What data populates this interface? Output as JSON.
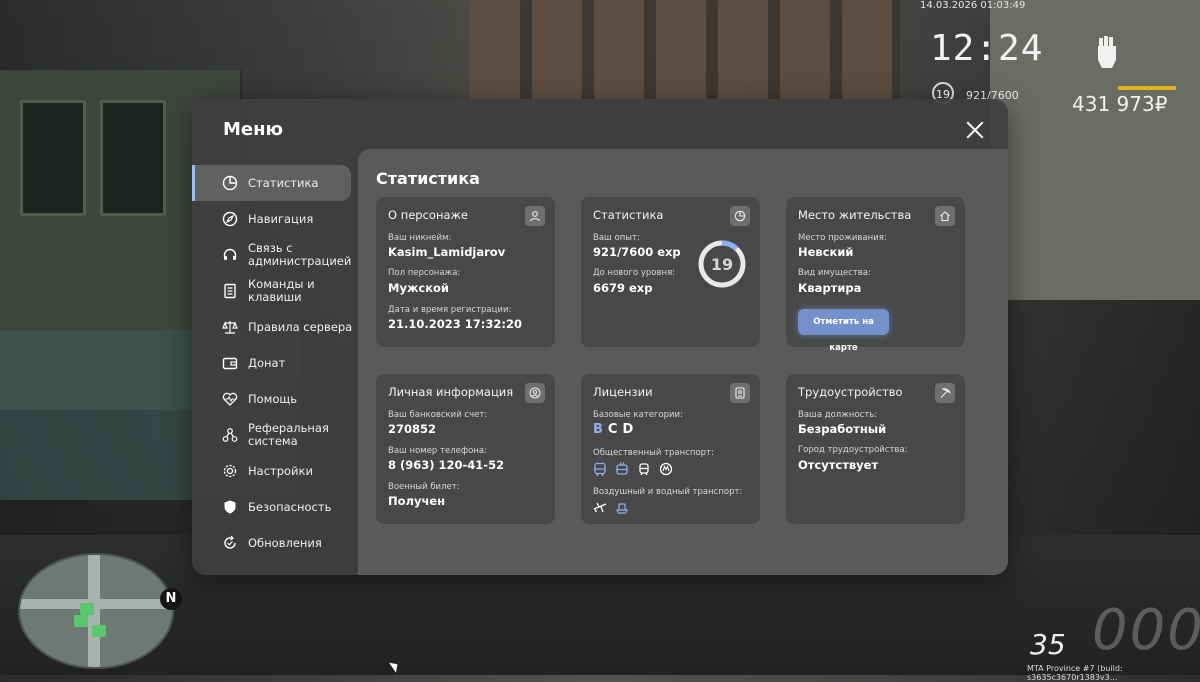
{
  "hud": {
    "date": "14.03.2026 01:03:49",
    "time": "12:24",
    "level": "19",
    "xp": "921/7600",
    "money": "431 973₽",
    "speed": "35",
    "speed_big": "000",
    "north": "N",
    "build_info": "MTA Province #7 (build: s3635c3670r1383v3..."
  },
  "menu": {
    "title": "Меню",
    "sidebar": [
      {
        "label": "Статистика",
        "icon": "pie-chart-icon"
      },
      {
        "label": "Навигация",
        "icon": "compass-icon"
      },
      {
        "label": "Связь с администрацией",
        "icon": "headset-icon"
      },
      {
        "label": "Команды и клавиши",
        "icon": "document-icon"
      },
      {
        "label": "Правила сервера",
        "icon": "scales-icon"
      },
      {
        "label": "Донат",
        "icon": "wallet-icon"
      },
      {
        "label": "Помощь",
        "icon": "heart-pulse-icon"
      },
      {
        "label": "Реферальная система",
        "icon": "network-icon"
      },
      {
        "label": "Настройки",
        "icon": "gear-icon"
      },
      {
        "label": "Безопасность",
        "icon": "shield-icon"
      },
      {
        "label": "Обновления",
        "icon": "refresh-icon"
      }
    ]
  },
  "stats": {
    "title": "Статистика",
    "character": {
      "title": "О персонаже",
      "nick_label": "Ваш никнейм:",
      "nick": "Kasim_Lamidjarov",
      "gender_label": "Пол персонажа:",
      "gender": "Мужской",
      "reg_label": "Дата и время регистрации:",
      "reg": "21.10.2023 17:32:20"
    },
    "statistics": {
      "title": "Статистика",
      "exp_label": "Ваш опыт:",
      "exp": "921/7600 exp",
      "next_label": "До нового уровня:",
      "next": "6679 exp",
      "level": "19",
      "progress": 0.121
    },
    "residence": {
      "title": "Место жительства",
      "place_label": "Место проживания:",
      "place": "Невский",
      "type_label": "Вид имущества:",
      "type": "Квартира",
      "button": "Отметить на карте"
    },
    "personal": {
      "title": "Личная информация",
      "bank_label": "Ваш банковский счет:",
      "bank": "270852",
      "phone_label": "Ваш номер телефона:",
      "phone": "8 (963) 120-41-52",
      "military_label": "Военный билет:",
      "military": "Получен"
    },
    "licenses": {
      "title": "Лицензии",
      "base_label": "Базовые категории:",
      "cat_b": "B",
      "cat_c": "C",
      "cat_d": "D",
      "public_label": "Общественный транспорт:",
      "air_label": "Воздушный и водный транспорт:"
    },
    "employment": {
      "title": "Трудоустройство",
      "position_label": "Ваша должность:",
      "position": "Безработный",
      "city_label": "Город трудоустройства:",
      "city": "Отсутствует"
    }
  },
  "colors": {
    "accent": "#7591cc",
    "active_category": "#8fb0ee",
    "cash_bar": "#e3b21e"
  }
}
